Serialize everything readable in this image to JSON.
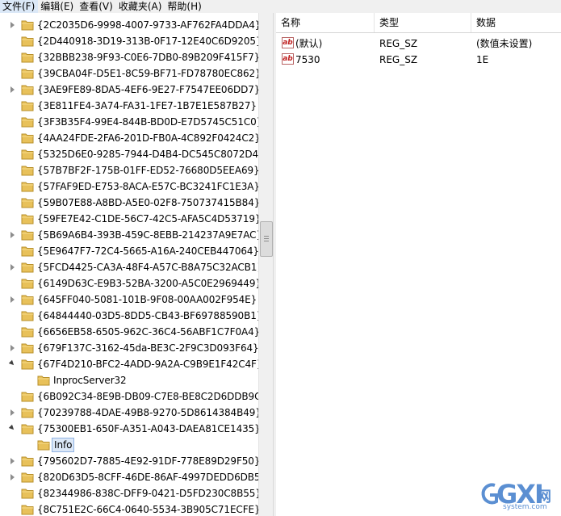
{
  "menu": [
    "文件(F)",
    "编辑(E)",
    "查看(V)",
    "收藏夹(A)",
    "帮助(H)"
  ],
  "tree": [
    {
      "label": "{2C2035D6-9998-4007-9733-AF762FA4DDA4}",
      "level": 1,
      "state": "collapsed"
    },
    {
      "label": "{2D440918-3D19-313B-0F17-12E40C6D9205}",
      "level": 1,
      "state": "none"
    },
    {
      "label": "{32BBB238-9F93-C0E6-7DB0-89B209F415F7}",
      "level": 1,
      "state": "none"
    },
    {
      "label": "{39CBA04F-D5E1-8C59-BF71-FD78780EC862}",
      "level": 1,
      "state": "none"
    },
    {
      "label": "{3AE9FE89-8DA5-4EF6-9E27-F7547EE06DD7}",
      "level": 1,
      "state": "collapsed"
    },
    {
      "label": "{3E811FE4-3A74-FA31-1FE7-1B7E1E587B27}",
      "level": 1,
      "state": "none"
    },
    {
      "label": "{3F3B35F4-99E4-844B-BD0D-E7D5745C51C0}",
      "level": 1,
      "state": "none"
    },
    {
      "label": "{4AA24FDE-2FA6-201D-FB0A-4C892F0424C2}",
      "level": 1,
      "state": "none"
    },
    {
      "label": "{5325D6E0-9285-7944-D4B4-DC545C8072D4}",
      "level": 1,
      "state": "none"
    },
    {
      "label": "{57B7BF2F-175B-01FF-ED52-76680D5EEA69}",
      "level": 1,
      "state": "none"
    },
    {
      "label": "{57FAF9ED-E753-8ACA-E57C-BC3241FC1E3A}",
      "level": 1,
      "state": "none"
    },
    {
      "label": "{59B07E88-A8BD-A5E0-02F8-750737415B84}",
      "level": 1,
      "state": "none"
    },
    {
      "label": "{59FE7E42-C1DE-56C7-42C5-AFA5C4D53719}",
      "level": 1,
      "state": "none"
    },
    {
      "label": "{5B69A6B4-393B-459C-8EBB-214237A9E7AC}",
      "level": 1,
      "state": "collapsed"
    },
    {
      "label": "{5E9647F7-72C4-5665-A16A-240CEB447064}",
      "level": 1,
      "state": "none"
    },
    {
      "label": "{5FCD4425-CA3A-48F4-A57C-B8A75C32ACB1}",
      "level": 1,
      "state": "collapsed"
    },
    {
      "label": "{6149D63C-E9B3-52BA-3200-A5C0E2969449}",
      "level": 1,
      "state": "none"
    },
    {
      "label": "{645FF040-5081-101B-9F08-00AA002F954E}",
      "level": 1,
      "state": "collapsed"
    },
    {
      "label": "{64844440-03D5-8DD5-CB43-BF69788590B1}",
      "level": 1,
      "state": "none"
    },
    {
      "label": "{6656EB58-6505-962C-36C4-56ABF1C7F0A4}",
      "level": 1,
      "state": "none"
    },
    {
      "label": "{679F137C-3162-45da-BE3C-2F9C3D093F64}",
      "level": 1,
      "state": "collapsed"
    },
    {
      "label": "{67F4D210-BFC2-4ADD-9A2A-C9B9E1F42C4F}",
      "level": 1,
      "state": "expanded"
    },
    {
      "label": "InprocServer32",
      "level": 2,
      "state": "none"
    },
    {
      "label": "{6B092C34-8E9B-DB09-C7E8-BE8C2D6DDB9C}",
      "level": 1,
      "state": "none"
    },
    {
      "label": "{70239788-4DAE-49B8-9270-5D8614384B49}",
      "level": 1,
      "state": "collapsed"
    },
    {
      "label": "{75300EB1-650F-A351-A043-DAEA81CE1435}",
      "level": 1,
      "state": "expanded"
    },
    {
      "label": "Info",
      "level": 2,
      "state": "none",
      "selected": true
    },
    {
      "label": "{795602D7-7885-4E92-91DF-778E89D29F50}",
      "level": 1,
      "state": "collapsed"
    },
    {
      "label": "{820D63D5-8CFF-46DE-86AF-4997DEDD6DB5}",
      "level": 1,
      "state": "collapsed"
    },
    {
      "label": "{82344986-838C-DFF9-0421-D5FD230C8B55}",
      "level": 1,
      "state": "none"
    },
    {
      "label": "{8C751E2C-66C4-0640-5534-3B905C71ECFE}",
      "level": 1,
      "state": "none"
    }
  ],
  "values": {
    "columns": [
      "名称",
      "类型",
      "数据"
    ],
    "rows": [
      {
        "name": "(默认)",
        "type": "REG_SZ",
        "data": "(数值未设置)"
      },
      {
        "name": "7530",
        "type": "REG_SZ",
        "data": "1E"
      }
    ],
    "icon_text": "ab"
  },
  "watermark": {
    "main": "GXI",
    "cn": "网",
    "sub": "system.com"
  },
  "colors": {
    "folder": "#e8c15a",
    "selection": "#dbe7f7",
    "watermark": "#5b8fd2"
  }
}
